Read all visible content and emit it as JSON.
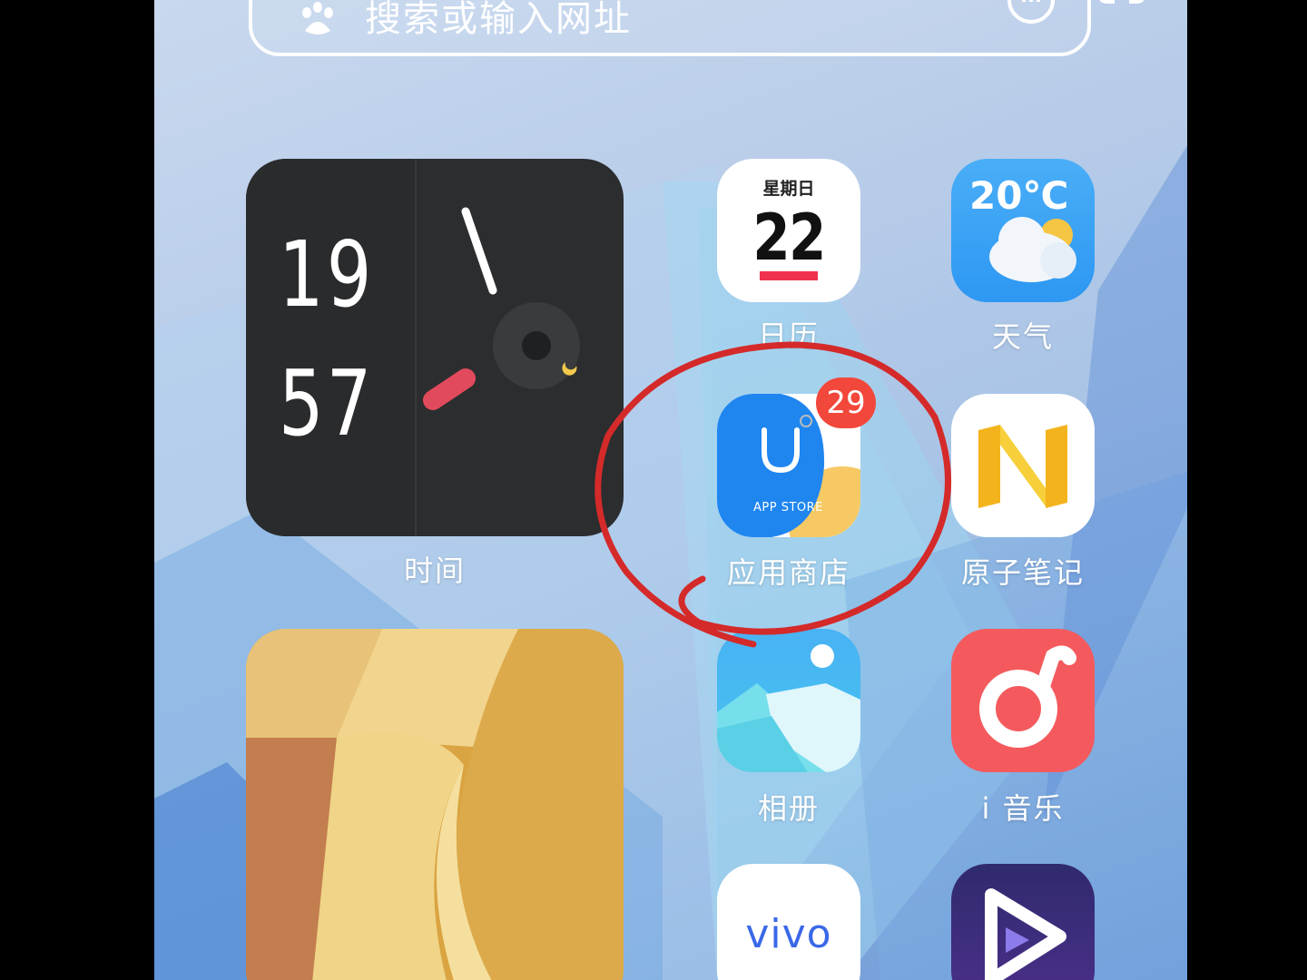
{
  "search": {
    "placeholder": "搜索或输入网址"
  },
  "clock_widget": {
    "hour": "19",
    "minute": "57",
    "label": "时间"
  },
  "apps": {
    "calendar": {
      "label": "日历",
      "weekday": "星期日",
      "day": "22"
    },
    "weather": {
      "label": "天气",
      "temperature": "20℃"
    },
    "app_store": {
      "label": "应用商店",
      "badge": "29",
      "icon_text": "APP STORE"
    },
    "atom_notes": {
      "label": "原子笔记"
    },
    "album": {
      "label": "相册"
    },
    "i_music": {
      "label": "i 音乐"
    },
    "vivo": {
      "wordmark": "vivo"
    },
    "video": {}
  },
  "colors": {
    "badge": "#f2473b",
    "annotation_circle": "#d42a2a",
    "calendar_accent": "#f0324f"
  }
}
